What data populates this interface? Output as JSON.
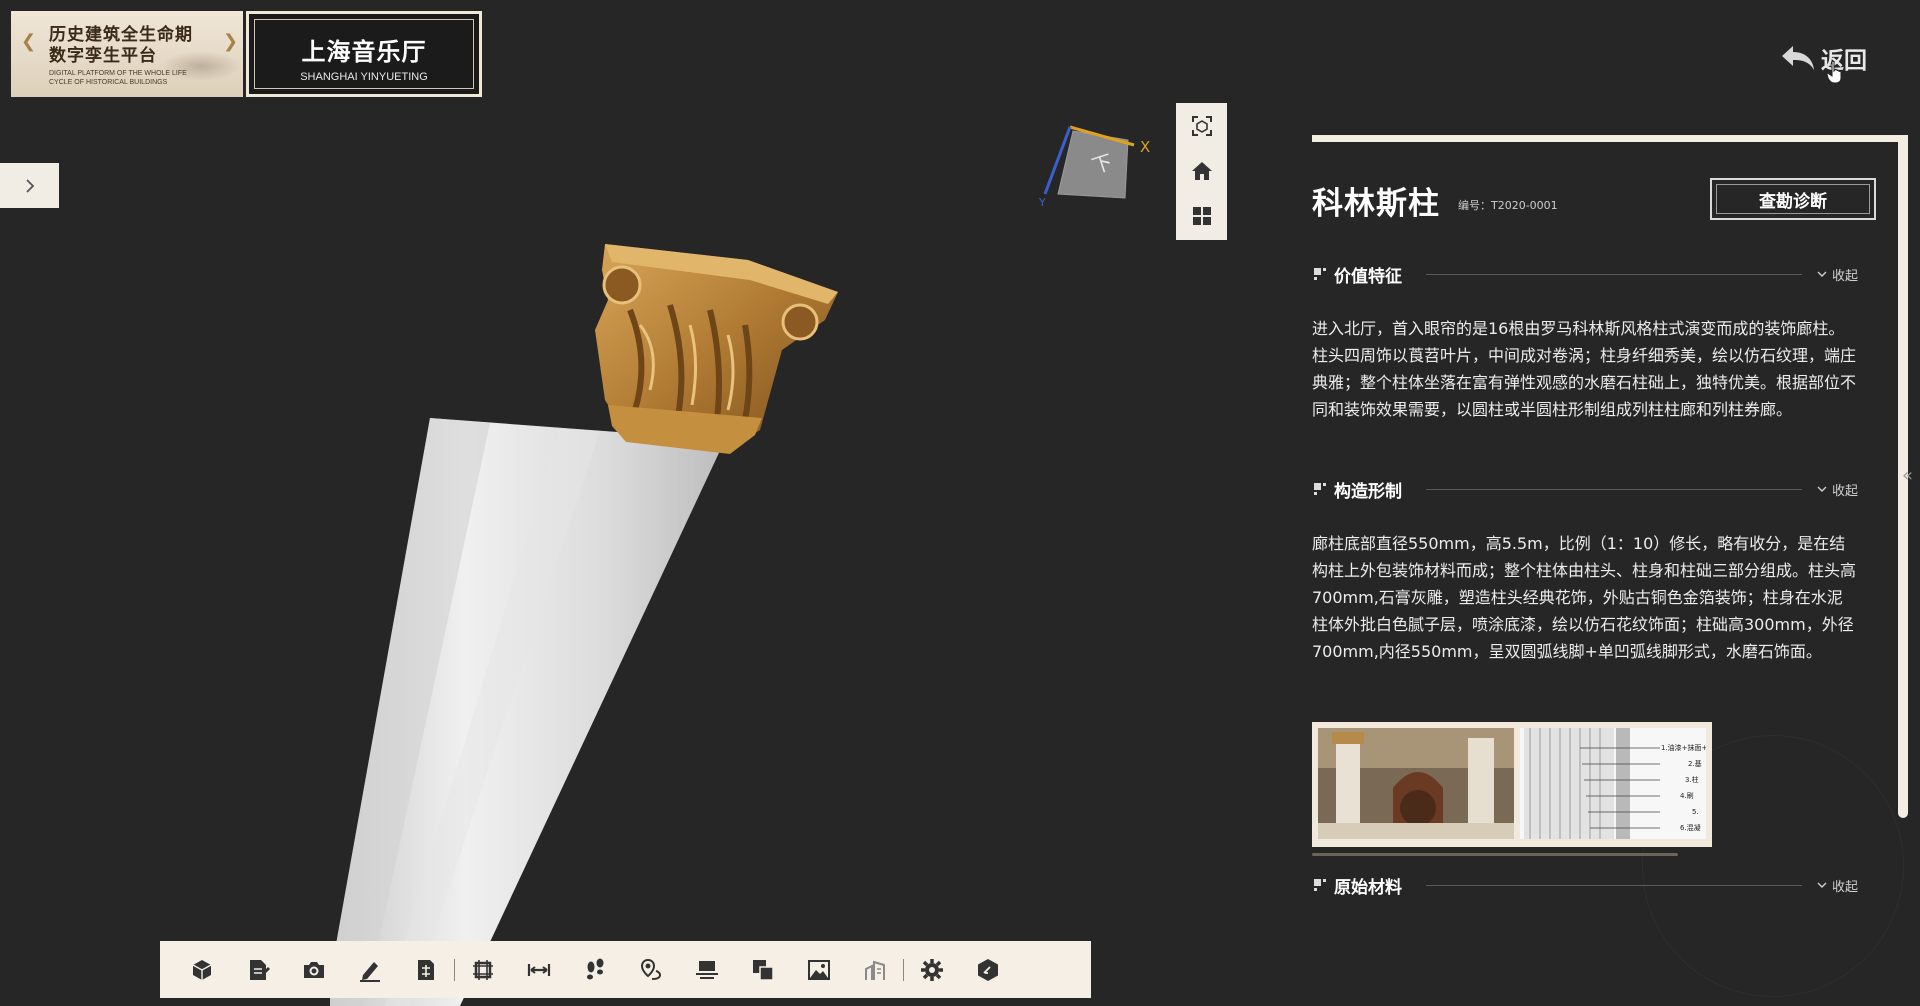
{
  "logo": {
    "title_line1": "历史建筑全生命期",
    "title_line2": "数字孪生平台",
    "subtitle_line1": "DIGITAL PLATFORM OF THE WHOLE LIFE",
    "subtitle_line2": "CYCLE OF HISTORICAL BUILDINGS"
  },
  "venue": {
    "name_cn": "上海音乐厅",
    "name_en": "SHANGHAI YINYUETING"
  },
  "return_label": "返回",
  "navcube": {
    "face_label": "下",
    "axis_x": "X",
    "axis_y": "Y"
  },
  "view_tools": [
    {
      "icon": "fit-view-icon"
    },
    {
      "icon": "home-icon"
    },
    {
      "icon": "grid-icon"
    }
  ],
  "toolbar": [
    "cube-icon",
    "document-icon",
    "camera-icon",
    "pen-icon",
    "layout-icon",
    "sep",
    "section-icon",
    "measure-icon",
    "walk-icon",
    "location-icon",
    "floor-icon",
    "layers-icon",
    "image-icon",
    "building-icon",
    "sep",
    "settings-icon",
    "info-icon"
  ],
  "panel": {
    "title": "科林斯柱",
    "code_label": "编号：",
    "code_value": "T2020-0001",
    "diagnose_label": "查勘诊断",
    "sections": [
      {
        "title": "价值特征",
        "toggle": "收起",
        "body": "进入北厅，首入眼帘的是16根由罗马科林斯风格柱式演变而成的装饰廊柱。柱头四周饰以莨苕叶片，中间成对卷涡；柱身纤细秀美，绘以仿石纹理，端庄典雅；整个柱体坐落在富有弹性观感的水磨石柱础上，独特优美。根据部位不同和装饰效果需要，以圆柱或半圆柱形制组成列柱柱廊和列柱券廊。"
      },
      {
        "title": "构造形制",
        "toggle": "收起",
        "body": "廊柱底部直径550mm，高5.5m，比例（1：10）修长，略有收分，是在结构柱上外包装饰材料而成；整个柱体由柱头、柱身和柱础三部分组成。柱头高700mm,石膏灰雕，塑造柱头经典花饰，外贴古铜色金箔装饰；柱身在水泥柱体外批白色腻子层，喷涂底漆，绘以仿石花纹饰面；柱础高300mm，外径700mm,内径550mm，呈双圆弧线脚+单凹弧线脚形式，水磨石饰面。"
      },
      {
        "title": "原始材料",
        "toggle": "收起"
      }
    ],
    "image_labels": [
      "1.油漆+抹面+",
      "2.基",
      "3.柱",
      "4.刷",
      "5.",
      "6.混凝"
    ]
  }
}
